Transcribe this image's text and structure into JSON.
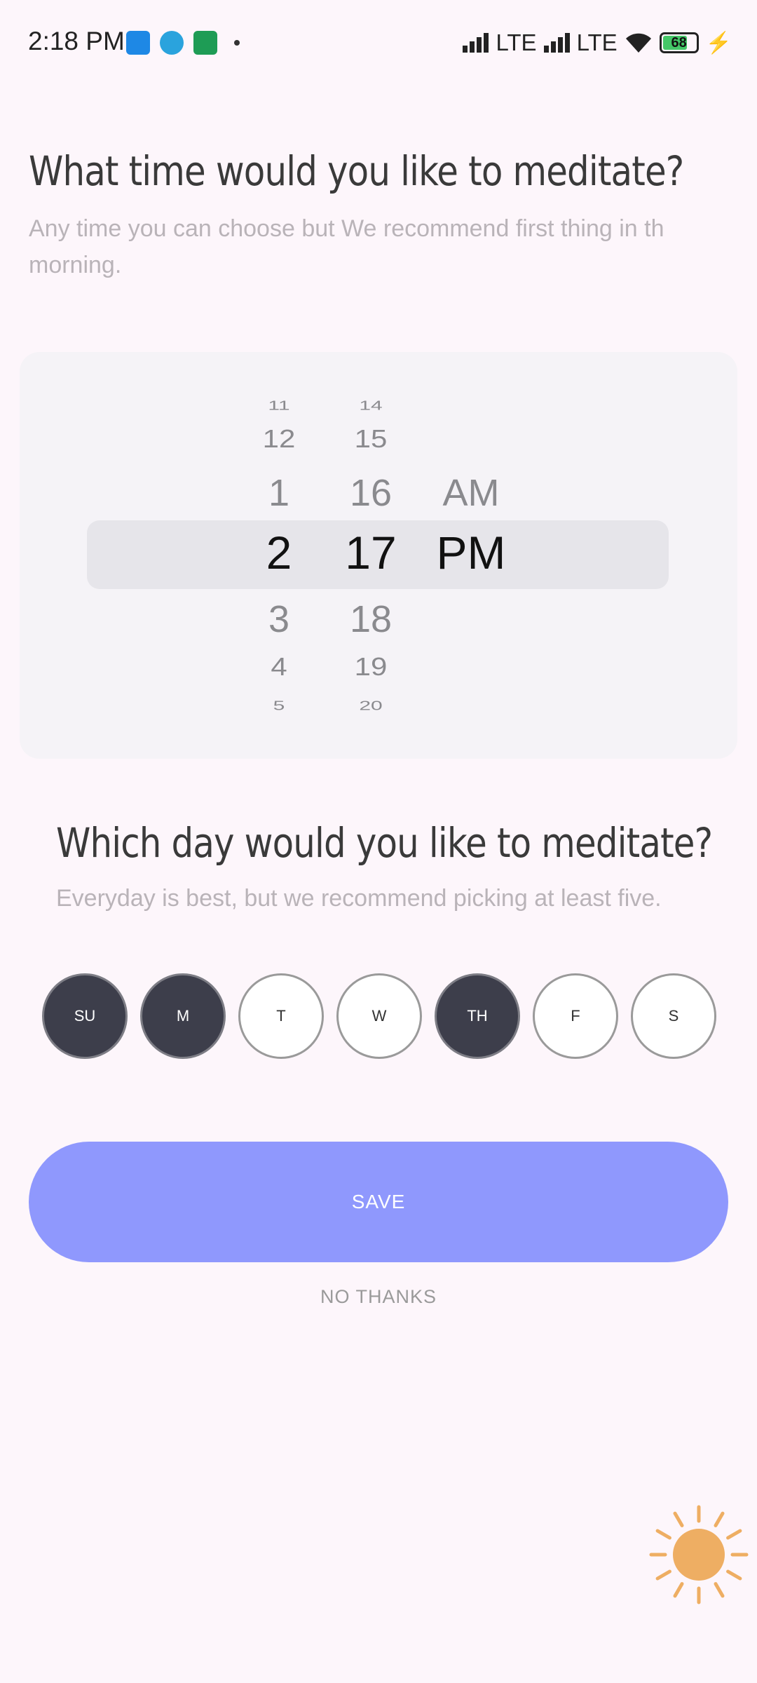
{
  "status_bar": {
    "time": "2:18 PM",
    "network_1": "LTE",
    "network_2": "LTE",
    "battery": "68",
    "icons": [
      "app-notification-icon",
      "telegram-icon",
      "book-icon",
      "wifi-icon",
      "charging-icon"
    ]
  },
  "time_section": {
    "title": "What time would you like to meditate?",
    "subtitle": "Any time you can choose but We recommend first thing in th morning."
  },
  "picker": {
    "hours": [
      "11",
      "12",
      "1",
      "2",
      "3",
      "4",
      "5"
    ],
    "minutes": [
      "14",
      "15",
      "16",
      "17",
      "18",
      "19",
      "20"
    ],
    "periods": [
      "AM",
      "PM"
    ],
    "selected": {
      "hour": "2",
      "minute": "17",
      "period": "PM"
    }
  },
  "day_section": {
    "title": "Which day would you like to meditate?",
    "subtitle": "Everyday is best, but we recommend picking at least five."
  },
  "days": [
    {
      "label": "SU",
      "selected": true
    },
    {
      "label": "M",
      "selected": true
    },
    {
      "label": "T",
      "selected": false
    },
    {
      "label": "W",
      "selected": false
    },
    {
      "label": "TH",
      "selected": true
    },
    {
      "label": "F",
      "selected": false
    },
    {
      "label": "S",
      "selected": false
    }
  ],
  "actions": {
    "save_label": "SAVE",
    "no_thanks_label": "NO THANKS"
  },
  "colors": {
    "background": "#fdf6fb",
    "accent": "#8f98fd",
    "day_selected": "#3d3e4b",
    "sun": "#eeae63"
  }
}
